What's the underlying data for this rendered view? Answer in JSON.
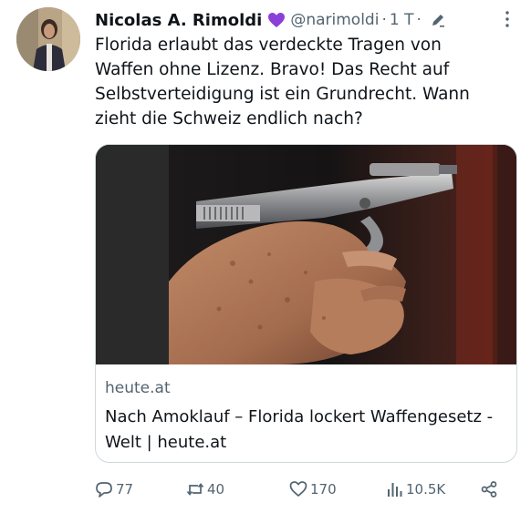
{
  "author": {
    "name": "Nicolas A. Rimoldi",
    "handle": "@narimoldi",
    "separator": "·",
    "time": "1 T",
    "separator2": "·"
  },
  "tweet": {
    "text": "Florida erlaubt das verdeckte Tragen von Waffen ohne Lizenz. Bravo! Das Recht auf Selbstverteidigung ist ein Grundrecht. Wann zieht die Schweiz endlich nach?"
  },
  "card": {
    "domain": "heute.at",
    "title": "Nach Amoklauf – Florida lockert Waffengesetz - Welt | heute.at"
  },
  "actions": {
    "replies": "77",
    "retweets": "40",
    "likes": "170",
    "views": "10.5K"
  },
  "colors": {
    "text": "#0f1419",
    "secondary": "#536471",
    "border": "#cfd9de",
    "heart": "#8b3fd9"
  },
  "icons": [
    "purple-heart-icon",
    "edit-icon",
    "more-icon",
    "reply-icon",
    "retweet-icon",
    "like-icon",
    "views-icon",
    "share-icon"
  ]
}
